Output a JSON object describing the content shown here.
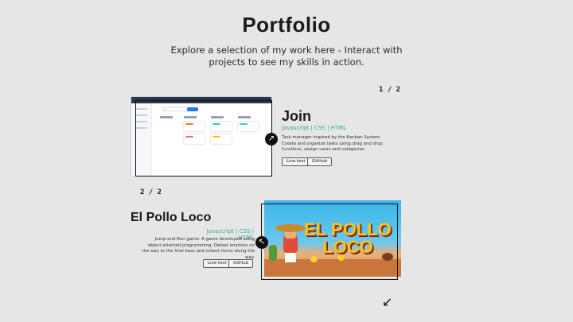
{
  "header": {
    "title": "Portfolio",
    "subtitle": "Explore a selection of my work here - Interact with projects to see my skills in action."
  },
  "projects": [
    {
      "counter": "1 / 2",
      "name": "Join",
      "tech": "Javascript | CSS | HTML",
      "description": "Task manager inspired by the Kanban System. Create and organize tasks using drag and drop functions, assign users and categories.",
      "live_label": "Live test",
      "github_label": "GitHub",
      "arrow_icon": "arrow-up-right-icon"
    },
    {
      "counter": "2 / 2",
      "name": "El Pollo Loco",
      "tech": "Javascript | CSS | HTML",
      "description": "Jump-and-Run game: A game developed using object-oriented programming. Defeat enemies on the way to the final boss and collect items along the way.",
      "live_label": "Live test",
      "github_label": "GitHub",
      "arrow_icon": "arrow-up-left-icon",
      "thumbnail_logo": "EL POLLO LOCO"
    }
  ],
  "footer": {
    "scroll_icon": "arrow-down-left-icon"
  },
  "colors": {
    "background": "#e6e6e6",
    "accent": "#3aa89a",
    "text": "#1a1a1a"
  }
}
